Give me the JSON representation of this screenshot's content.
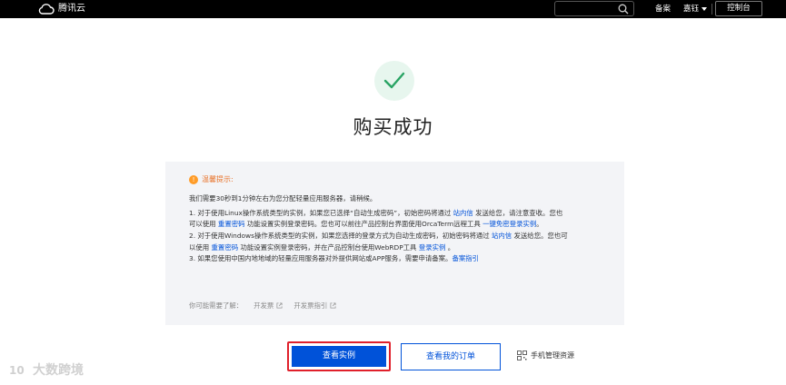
{
  "header": {
    "logo_text": "腾讯云",
    "search_placeholder": "",
    "nav_beian": "备案",
    "nav_user": "嘉钰",
    "console_button": "控制台"
  },
  "main": {
    "title": "购买成功",
    "tip_title": "温馨提示:",
    "line1": "我们需要30秒到1分钟左右为您分配轻量应用服务器，请稍候。",
    "line2_a": "1. 对于使用Linux操作系统类型的实例，如果您已选择“自动生成密码”，初始密码将通过 ",
    "line2_link": "站内信",
    "line2_b": " 发送给您，请注意查收。您也",
    "line3_a": "可以使用 ",
    "line3_link1": "重置密码",
    "line3_b": " 功能设置实例登录密码。您也可以前往产品控制台界面使用OrcaTerm远程工具 ",
    "line3_link2": "一键免密登录实例",
    "line3_c": "。",
    "line4_a": "2. 对于使用Windows操作系统类型的实例，如果您选择的登录方式为自动生成密码，初始密码将通过 ",
    "line4_link": "站内信",
    "line4_b": " 发送给您。您也可",
    "line5_a": "以使用 ",
    "line5_link1": "重置密码",
    "line5_b": " 功能设置实例登录密码，并在产品控制台使用WebRDP工具 ",
    "line5_link2": "登录实例",
    "line5_c": " 。",
    "line6_a": "3. 如果您使用中国内地地域的轻量应用服务器对外提供网站或APP服务，需要申请备案。",
    "line6_link": "备案指引",
    "more_label": "你可能需要了解：",
    "more_item1": "开发票",
    "more_item2": "开发票指引"
  },
  "actions": {
    "view_instance": "查看实例",
    "view_orders": "查看我的订单",
    "mobile_manage": "手机管理资源"
  },
  "watermark": {
    "text": "大数跨境"
  },
  "colors": {
    "brand_blue": "#0052d9",
    "success_green": "#29a464",
    "warning_orange": "#ff9c28",
    "highlight_red": "#e0202b"
  }
}
